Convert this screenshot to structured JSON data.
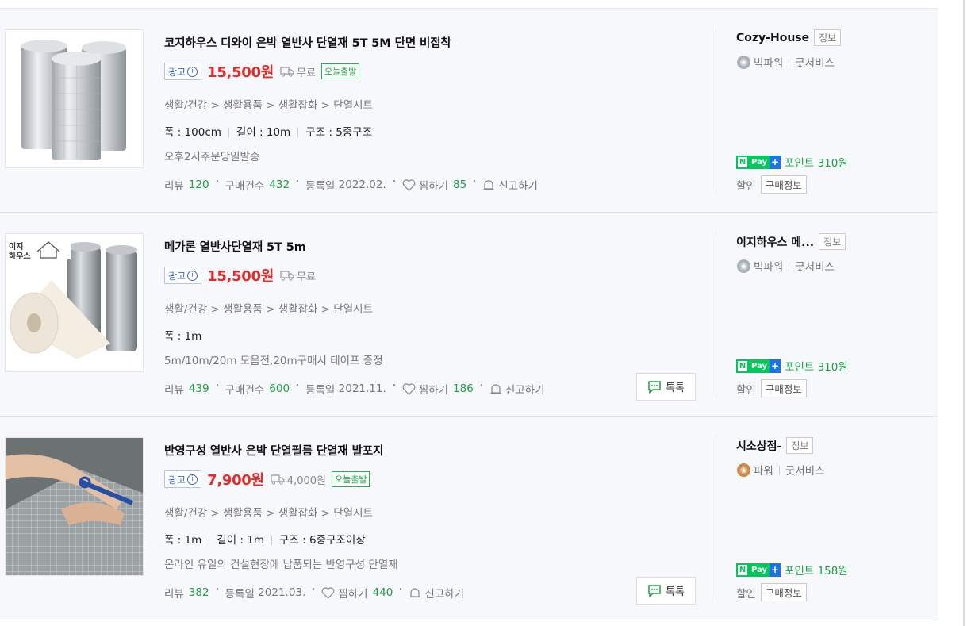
{
  "products": [
    {
      "title": "코지하우스 디와이 은박 열반사 단열재 5T 5M 단면 비접착",
      "ad_label": "광고",
      "ad_info": "i",
      "price": "15,500원",
      "shipping": "무료",
      "today_badge": "오늘출발",
      "category": "생활/건강 > 생활용품 > 생활잡화 > 단열시트",
      "specs": [
        "폭 : 100cm",
        "길이 : 10m",
        "구조 : 5중구조"
      ],
      "desc": "오후2시주문당일발송",
      "review_label": "리뷰",
      "review_count": "120",
      "purchase_label": "구매건수",
      "purchase_count": "432",
      "reg_label": "등록일",
      "reg_date": "2022.02.",
      "zzim_label": "찜하기",
      "zzim_count": "85",
      "report_label": "신고하기",
      "talk_label": "",
      "seller": "Cozy-House",
      "seller_tag": "정보",
      "grade": "빅파워",
      "service": "굿서비스",
      "npay_n": "N",
      "npay_pay": "Pay",
      "npay_plus": "+",
      "points": "포인트 310원",
      "discount_label": "할인",
      "purchase_info": "구매정보",
      "medal_color": "#a9b0b8"
    },
    {
      "title": "메가론 열반사단열재 5T 5m",
      "ad_label": "광고",
      "ad_info": "i",
      "price": "15,500원",
      "shipping": "무료",
      "today_badge": "",
      "category": "생활/건강 > 생활용품 > 생활잡화 > 단열시트",
      "specs": [
        "폭 : 1m"
      ],
      "desc": "5m/10m/20m 모음전,20m구매시 테이프 증정",
      "review_label": "리뷰",
      "review_count": "439",
      "purchase_label": "구매건수",
      "purchase_count": "600",
      "reg_label": "등록일",
      "reg_date": "2021.11.",
      "zzim_label": "찜하기",
      "zzim_count": "186",
      "report_label": "신고하기",
      "talk_label": "톡톡",
      "seller": "이지하우스 메...",
      "seller_tag": "정보",
      "grade": "빅파워",
      "service": "굿서비스",
      "npay_n": "N",
      "npay_pay": "Pay",
      "npay_plus": "+",
      "points": "포인트 310원",
      "discount_label": "할인",
      "purchase_info": "구매정보",
      "medal_color": "#a9b0b8",
      "brand_logo_text": [
        "이지",
        "하우스"
      ]
    },
    {
      "title": "반영구성 열반사 은박 단열필름 단열재 발포지",
      "ad_label": "광고",
      "ad_info": "i",
      "price": "7,900원",
      "shipping": "4,000원",
      "today_badge": "오늘출발",
      "category": "생활/건강 > 생활용품 > 생활잡화 > 단열시트",
      "specs": [
        "폭 : 1m",
        "길이 : 1m",
        "구조 : 6중구조이상"
      ],
      "desc": "온라인 유일의 건설현장에 납품되는 반영구성 단열재",
      "review_label": "리뷰",
      "review_count": "382",
      "purchase_label": "",
      "purchase_count": "",
      "reg_label": "등록일",
      "reg_date": "2021.03.",
      "zzim_label": "찜하기",
      "zzim_count": "440",
      "report_label": "신고하기",
      "talk_label": "톡톡",
      "seller": "시소상점-",
      "seller_tag": "정보",
      "grade": "파워",
      "service": "굿서비스",
      "npay_n": "N",
      "npay_pay": "Pay",
      "npay_plus": "+",
      "points": "포인트 158원",
      "discount_label": "할인",
      "purchase_info": "구매정보",
      "medal_color": "#c8884a"
    }
  ]
}
